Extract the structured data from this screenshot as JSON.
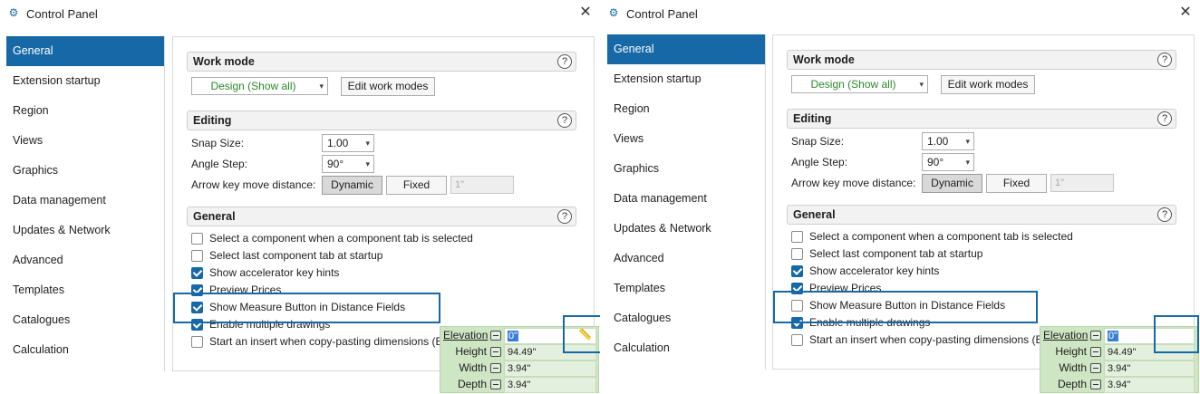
{
  "windows": [
    {
      "id": "left",
      "title": "Control Panel",
      "measure_option_checked": true,
      "show_measure_button": true
    },
    {
      "id": "right",
      "title": "Control Panel",
      "measure_option_checked": false,
      "show_measure_button": false
    }
  ],
  "sidebar": {
    "items": [
      {
        "label": "General",
        "active": true
      },
      {
        "label": "Extension startup"
      },
      {
        "label": "Region"
      },
      {
        "label": "Views"
      },
      {
        "label": "Graphics"
      },
      {
        "label": "Data management"
      },
      {
        "label": "Updates & Network"
      },
      {
        "label": "Advanced"
      },
      {
        "label": "Templates"
      },
      {
        "label": "Catalogues"
      },
      {
        "label": "Calculation"
      }
    ]
  },
  "work_mode": {
    "heading": "Work mode",
    "dropdown_value": "Design (Show all)",
    "edit_button": "Edit work modes"
  },
  "editing": {
    "heading": "Editing",
    "snap_size_label": "Snap Size:",
    "snap_size_value": "1.00",
    "angle_step_label": "Angle Step:",
    "angle_step_value": "90°",
    "arrow_key_label": "Arrow key move distance:",
    "dynamic_button": "Dynamic",
    "fixed_button": "Fixed",
    "distance_value": "1\""
  },
  "general": {
    "heading": "General",
    "options": [
      {
        "label": "Select a component when a component tab is selected"
      },
      {
        "label": "Select last component tab at startup"
      },
      {
        "label": "Show accelerator key hints"
      },
      {
        "label": "Preview Prices"
      },
      {
        "label": "Show Measure Button in Distance Fields"
      },
      {
        "label": "Enable multiple drawings"
      },
      {
        "label": "Start an insert when copy-pasting dimensions (E"
      }
    ]
  },
  "dimensions": {
    "rows": [
      {
        "label": "Elevation",
        "value": "0\""
      },
      {
        "label": "Height",
        "value": "94.49\""
      },
      {
        "label": "Width",
        "value": "3.94\""
      },
      {
        "label": "Depth",
        "value": "3.94\""
      }
    ]
  },
  "icons": {
    "app": "settings-gear-icon",
    "close": "close-x-icon",
    "help": "help-question-icon",
    "lock": "lock-icon",
    "measure": "measure-ruler-icon"
  },
  "colors": {
    "accent": "#1669a6",
    "work_mode_text": "#2b8a2b",
    "dimension_panel": "#cfe6c4"
  },
  "help_glyph": "?",
  "close_glyph": "✕"
}
